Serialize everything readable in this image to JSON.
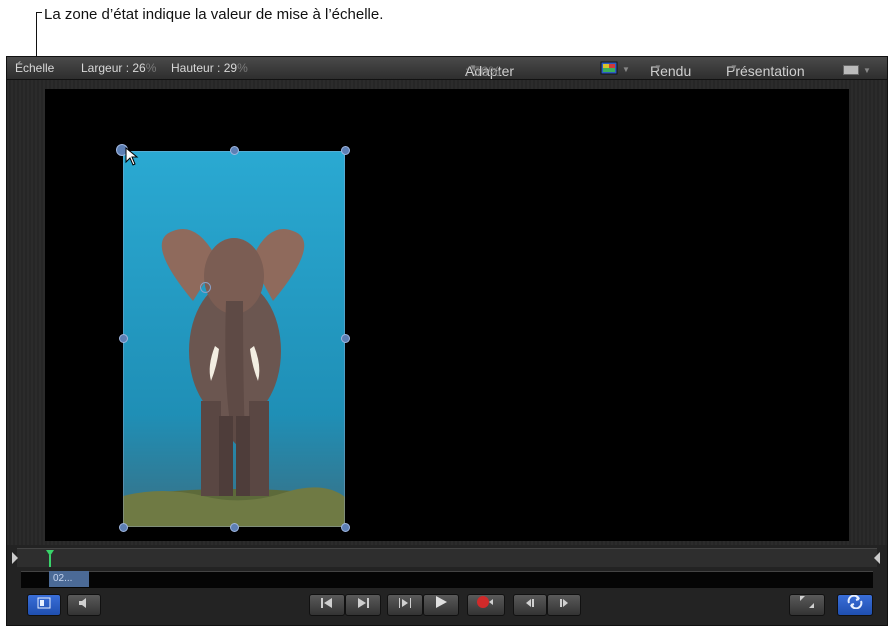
{
  "callout": "La zone d’état indique la valeur de mise à l’échelle.",
  "status_bar": {
    "tool": "Échelle",
    "width_label": "Largeur : ",
    "width_value": "26",
    "width_unit": "%",
    "height_label": "Hauteur : ",
    "height_value": "29",
    "height_unit": "%",
    "fit_label": "Adapter",
    "fit_value": " : 56%",
    "render_label": "Rendu",
    "view_label": "Présentation"
  },
  "timeline": {
    "clip_label": "02..."
  },
  "colors": {
    "canvas_bg": "#000000",
    "accent_blue": "#2a63d1",
    "record_red": "#d02a2a"
  },
  "icons": {
    "channels": "color-channels-icon",
    "layout": "layout-icon",
    "play": "play-icon",
    "record": "record-icon"
  }
}
